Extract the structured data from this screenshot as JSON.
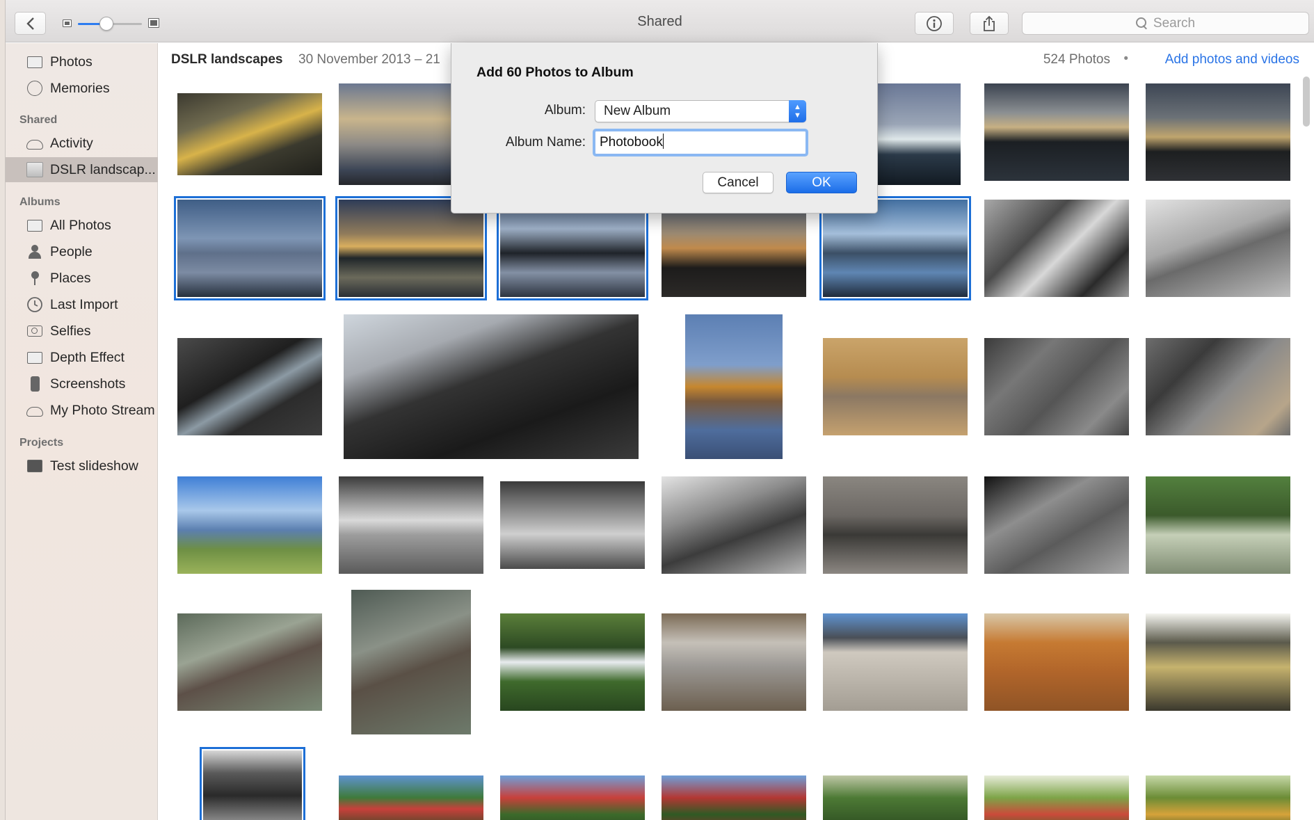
{
  "toolbar": {
    "title": "Shared",
    "search_placeholder": "Search",
    "zoom_level": 0.45
  },
  "sidebar": {
    "library_items": [
      {
        "label": "Photos",
        "icon": "photos-icon"
      },
      {
        "label": "Memories",
        "icon": "memories-icon"
      }
    ],
    "shared_header": "Shared",
    "shared_items": [
      {
        "label": "Activity",
        "icon": "cloud-icon"
      },
      {
        "label": "DSLR landscap...",
        "icon": "album-thumbnail-icon",
        "selected": true
      }
    ],
    "albums_header": "Albums",
    "album_items": [
      {
        "label": "All Photos",
        "icon": "all-photos-icon"
      },
      {
        "label": "People",
        "icon": "person-icon"
      },
      {
        "label": "Places",
        "icon": "pin-icon"
      },
      {
        "label": "Last Import",
        "icon": "clock-icon"
      },
      {
        "label": "Selfies",
        "icon": "camera-icon"
      },
      {
        "label": "Depth Effect",
        "icon": "depth-icon"
      },
      {
        "label": "Screenshots",
        "icon": "phone-icon"
      },
      {
        "label": "My Photo Stream",
        "icon": "cloud-icon"
      }
    ],
    "projects_header": "Projects",
    "project_items": [
      {
        "label": "Test slideshow",
        "icon": "slideshow-icon"
      }
    ]
  },
  "content": {
    "album_title": "DSLR landscapes",
    "album_dates": "30 November 2013 – 21",
    "photo_count": "524 Photos",
    "separator": "•",
    "add_link": "Add photos and videos"
  },
  "dialog": {
    "title": "Add 60 Photos to Album",
    "album_label": "Album:",
    "album_value": "New Album",
    "name_label": "Album Name:",
    "name_value": "Photobook",
    "cancel_label": "Cancel",
    "ok_label": "OK"
  },
  "colors": {
    "accent": "#1d6fd6",
    "link": "#2a74e6",
    "sidebar_selected": "#c8c0bc"
  }
}
